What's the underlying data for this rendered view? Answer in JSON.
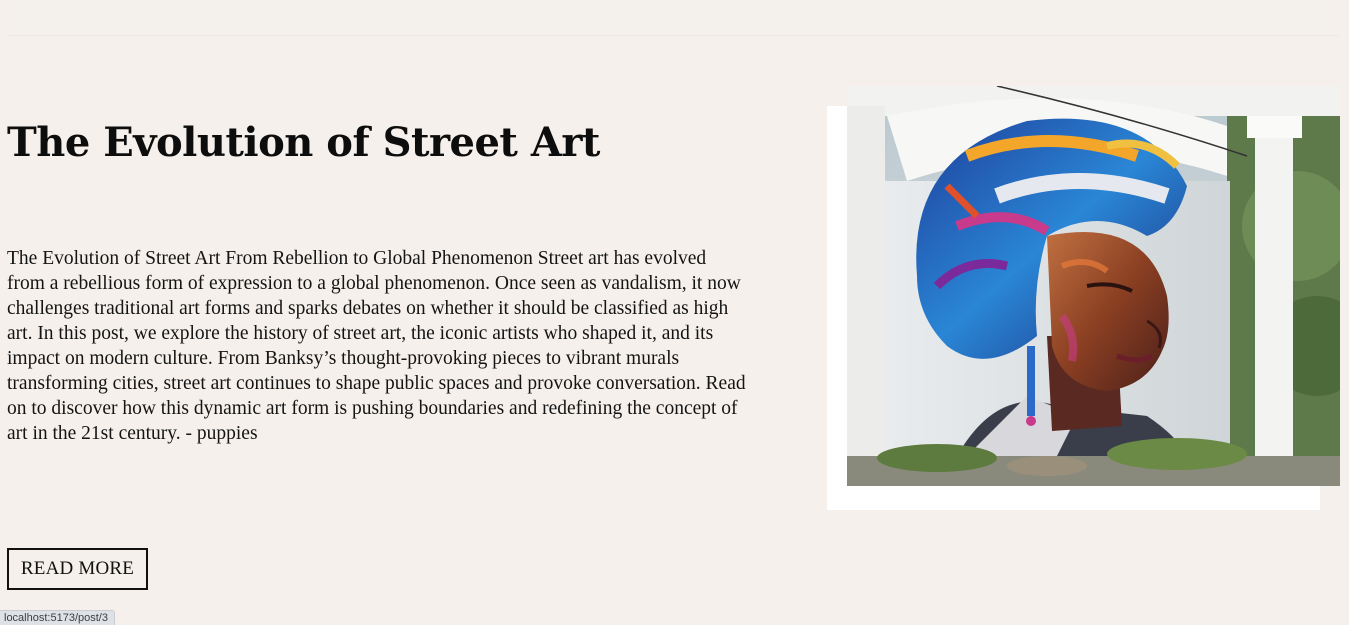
{
  "post": {
    "title": "The Evolution of Street Art",
    "excerpt": "The Evolution of Street Art From Rebellion to Global Phenomenon Street art has evolved from a rebellious form of expression to a global phenomenon. Once seen as vandalism, it now challenges traditional art forms and sparks debates on whether it should be classified as high art. In this post, we explore the history of street art, the iconic artists who shaped it, and its impact on modern culture. From Banksy’s thought-provoking pieces to vibrant murals transforming cities, street art continues to shape public spaces and provoke conversation. Read on to discover how this dynamic art form is pushing boundaries and redefining the concept of art in the 21st century. - puppies",
    "read_more_label": "READ MORE"
  },
  "browser": {
    "status_url": "localhost:5173/post/3"
  },
  "colors": {
    "page_background": "#f5f0eb",
    "text": "#111111",
    "frame": "#ffffff"
  }
}
